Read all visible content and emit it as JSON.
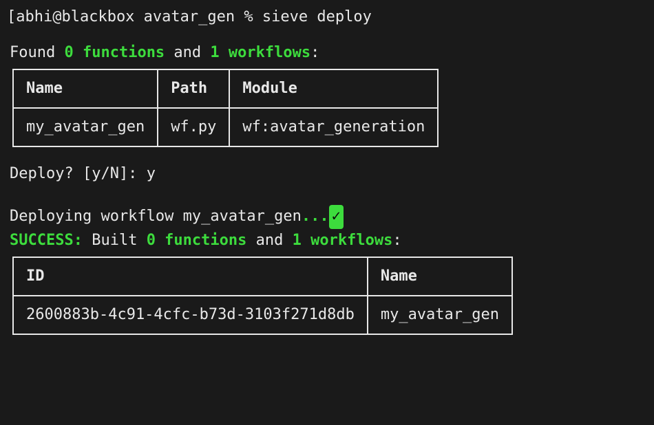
{
  "prompt": {
    "prefix": "[abhi@blackbox avatar_gen % ",
    "command": "sieve deploy"
  },
  "found": {
    "prefix": "Found ",
    "fn_count": "0 functions",
    "mid": " and ",
    "wf_count": "1 workflows",
    "suffix": ":"
  },
  "table1": {
    "headers": {
      "name": "Name",
      "path": "Path",
      "module": "Module"
    },
    "row": {
      "name": "my_avatar_gen",
      "path": "wf.py",
      "module": "wf:avatar_generation"
    }
  },
  "deploy_prompt": {
    "question": "Deploy? [y/N]: ",
    "answer": "y"
  },
  "deploying": {
    "prefix": "Deploying workflow my_avatar_gen",
    "dots": "...",
    "check": "✓"
  },
  "success": {
    "label": "SUCCESS:",
    "built": " Built ",
    "fn_count": "0 functions",
    "mid": " and ",
    "wf_count": "1 workflows",
    "suffix": ":"
  },
  "table2": {
    "headers": {
      "id": "ID",
      "name": "Name"
    },
    "row": {
      "id": "2600883b-4c91-4cfc-b73d-3103f271d8db",
      "name": "my_avatar_gen"
    }
  }
}
